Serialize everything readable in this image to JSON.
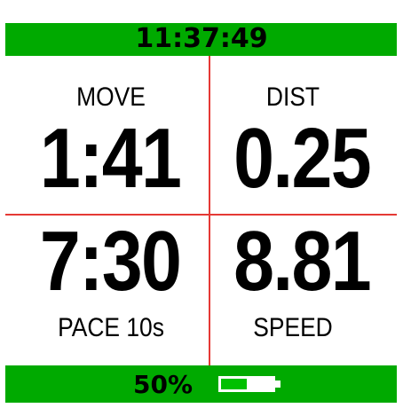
{
  "header": {
    "time": "11:37:49",
    "bar_color": "#00aa00"
  },
  "fields": {
    "move": {
      "label": "MOVE",
      "value": "1:41"
    },
    "dist": {
      "label": "DIST",
      "value": "0.25"
    },
    "pace": {
      "label": "PACE 10s",
      "value": "7:30"
    },
    "speed": {
      "label": "SPEED",
      "value": "8.81"
    }
  },
  "footer": {
    "battery_text": "50%",
    "battery_level": 0.5,
    "battery_fill_color": "#00c000",
    "battery_icon": "battery-icon"
  },
  "divider_color": "#e53935"
}
